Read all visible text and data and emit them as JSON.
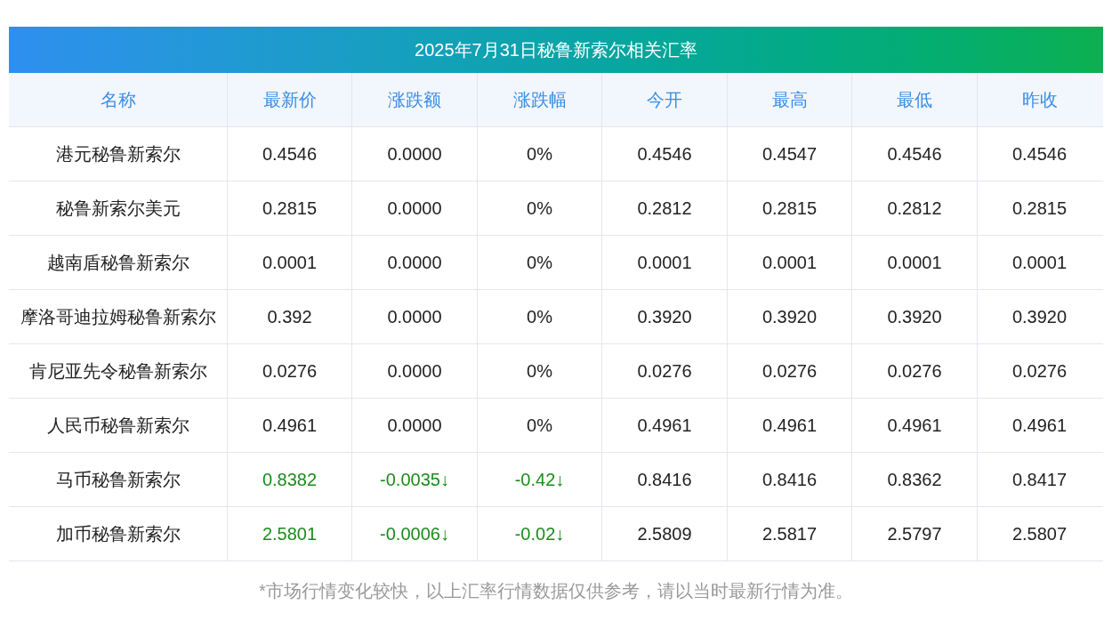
{
  "title": "2025年7月31日秘鲁新索尔相关汇率",
  "table": {
    "columns": [
      "名称",
      "最新价",
      "涨跌额",
      "涨跌幅",
      "今开",
      "最高",
      "最低",
      "昨收"
    ],
    "rows": [
      {
        "falling": false,
        "cells": [
          "港元秘鲁新索尔",
          "0.4546",
          "0.0000",
          "0%",
          "0.4546",
          "0.4547",
          "0.4546",
          "0.4546"
        ]
      },
      {
        "falling": false,
        "cells": [
          "秘鲁新索尔美元",
          "0.2815",
          "0.0000",
          "0%",
          "0.2812",
          "0.2815",
          "0.2812",
          "0.2815"
        ]
      },
      {
        "falling": false,
        "cells": [
          "越南盾秘鲁新索尔",
          "0.0001",
          "0.0000",
          "0%",
          "0.0001",
          "0.0001",
          "0.0001",
          "0.0001"
        ]
      },
      {
        "falling": false,
        "cells": [
          "摩洛哥迪拉姆秘鲁新索尔",
          "0.392",
          "0.0000",
          "0%",
          "0.3920",
          "0.3920",
          "0.3920",
          "0.3920"
        ]
      },
      {
        "falling": false,
        "cells": [
          "肯尼亚先令秘鲁新索尔",
          "0.0276",
          "0.0000",
          "0%",
          "0.0276",
          "0.0276",
          "0.0276",
          "0.0276"
        ]
      },
      {
        "falling": false,
        "cells": [
          "人民币秘鲁新索尔",
          "0.4961",
          "0.0000",
          "0%",
          "0.4961",
          "0.4961",
          "0.4961",
          "0.4961"
        ]
      },
      {
        "falling": true,
        "cells": [
          "马币秘鲁新索尔",
          "0.8382",
          "-0.0035↓",
          "-0.42↓",
          "0.8416",
          "0.8416",
          "0.8362",
          "0.8417"
        ]
      },
      {
        "falling": true,
        "cells": [
          "加币秘鲁新索尔",
          "2.5801",
          "-0.0006↓",
          "-0.02↓",
          "2.5809",
          "2.5817",
          "2.5797",
          "2.5807"
        ]
      }
    ]
  },
  "footnote": "*市场行情变化较快，以上汇率行情数据仅供参考，请以当时最新行情为准。"
}
